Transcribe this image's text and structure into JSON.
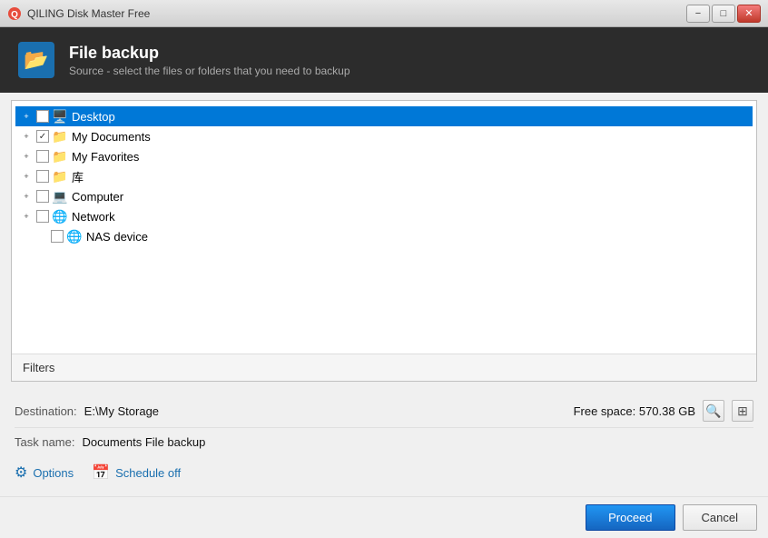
{
  "window": {
    "title": "QILING Disk Master Free",
    "min_label": "−",
    "max_label": "□",
    "close_label": "✕"
  },
  "header": {
    "icon": "📂",
    "title": "File backup",
    "subtitle": "Source - select the files or folders that you need to backup"
  },
  "tree": {
    "items": [
      {
        "id": "desktop",
        "label": "Desktop",
        "indent": 0,
        "selected": true,
        "checked": false,
        "icon_type": "desktop",
        "expandable": true
      },
      {
        "id": "my_documents",
        "label": "My Documents",
        "indent": 0,
        "selected": false,
        "checked": true,
        "icon_type": "folder",
        "expandable": true
      },
      {
        "id": "my_favorites",
        "label": "My Favorites",
        "indent": 0,
        "selected": false,
        "checked": false,
        "icon_type": "folder",
        "expandable": true
      },
      {
        "id": "ku",
        "label": "库",
        "indent": 0,
        "selected": false,
        "checked": false,
        "icon_type": "folder",
        "expandable": true
      },
      {
        "id": "computer",
        "label": "Computer",
        "indent": 0,
        "selected": false,
        "checked": false,
        "icon_type": "computer",
        "expandable": true
      },
      {
        "id": "network",
        "label": "Network",
        "indent": 0,
        "selected": false,
        "checked": false,
        "icon_type": "network",
        "expandable": true
      },
      {
        "id": "nas_device",
        "label": "NAS device",
        "indent": 1,
        "selected": false,
        "checked": false,
        "icon_type": "nas",
        "expandable": false
      }
    ]
  },
  "filters": {
    "label": "Filters"
  },
  "destination": {
    "label": "Destination:",
    "value": "E:\\My Storage",
    "free_space_label": "Free space: 570.38 GB"
  },
  "taskname": {
    "label": "Task name:",
    "value": "Documents File backup"
  },
  "options": {
    "options_label": "Options",
    "schedule_label": "Schedule off"
  },
  "actions": {
    "proceed_label": "Proceed",
    "cancel_label": "Cancel"
  }
}
